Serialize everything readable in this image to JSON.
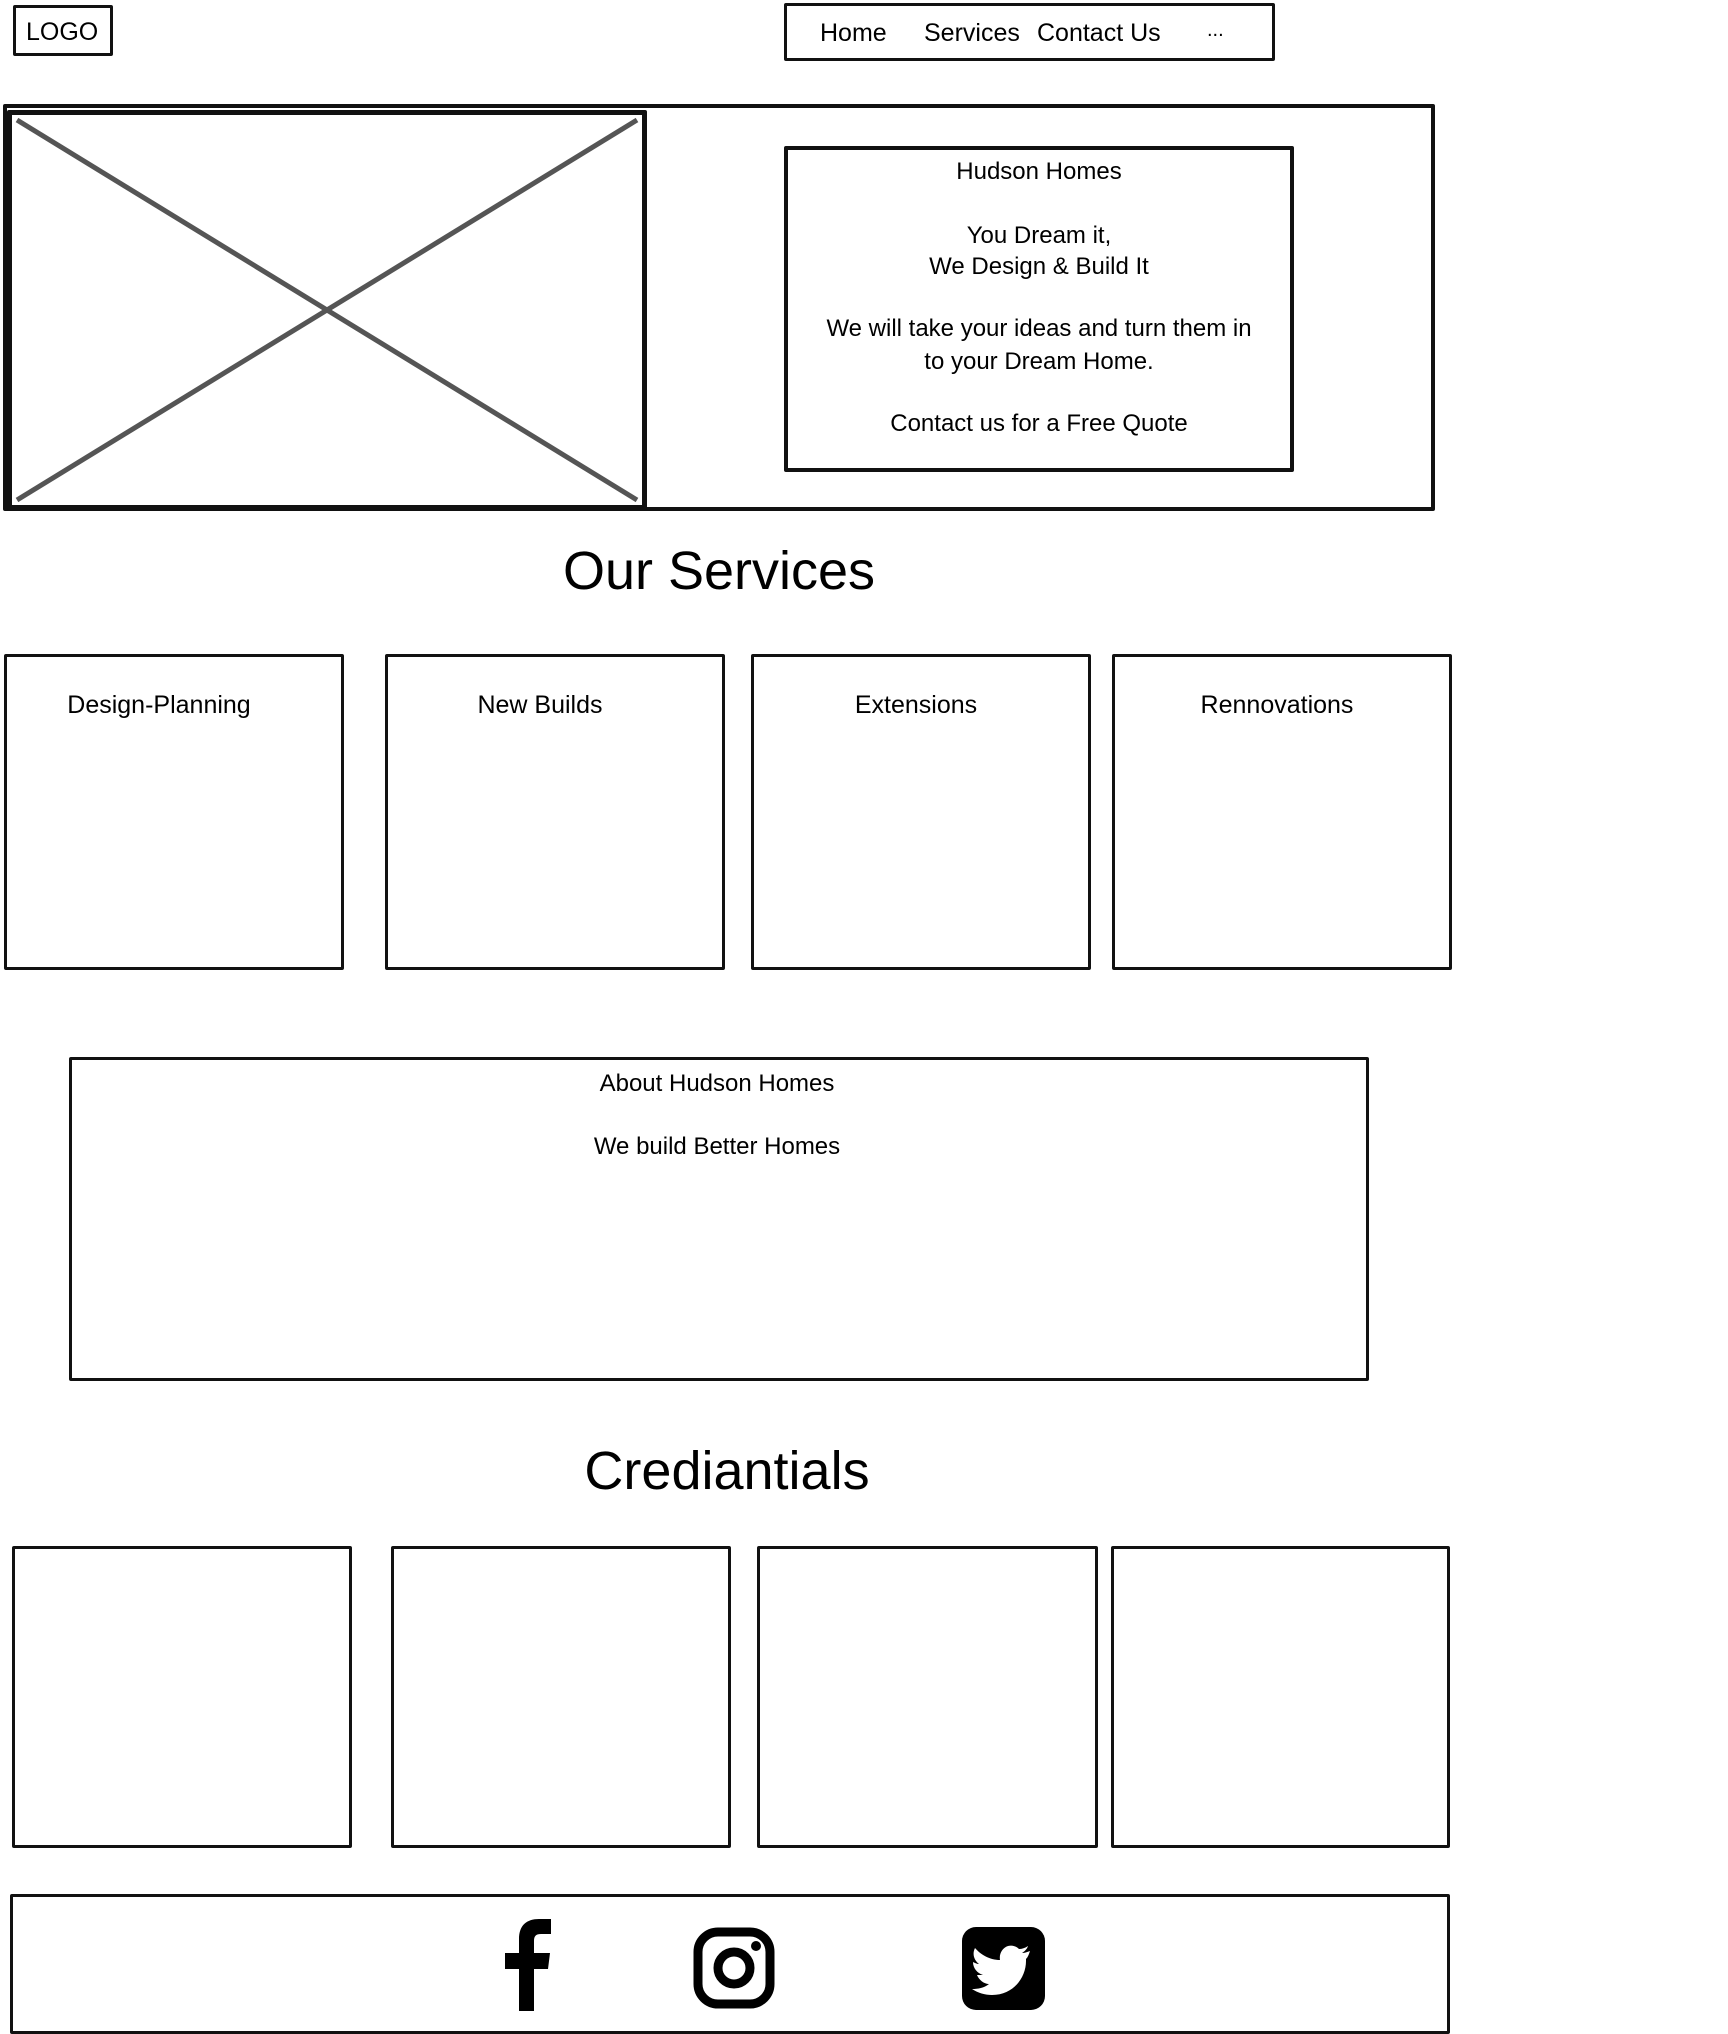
{
  "header": {
    "logo": "LOGO",
    "nav": [
      {
        "label": "Home"
      },
      {
        "label": "Services"
      },
      {
        "label": "Contact Us"
      },
      {
        "label": "..."
      }
    ]
  },
  "hero": {
    "title": "Hudson Homes",
    "tagline_1": "You Dream it,",
    "tagline_2": "We Design & Build It",
    "body_1": "We will take your ideas and turn them in",
    "body_2": "to your Dream Home.",
    "cta": "Contact us for a Free Quote"
  },
  "services": {
    "heading": "Our Services",
    "items": [
      {
        "label": "Design-Planning"
      },
      {
        "label": "New Builds"
      },
      {
        "label": "Extensions"
      },
      {
        "label": "Rennovations"
      }
    ]
  },
  "about": {
    "title": "About Hudson Homes",
    "text": "We build Better Homes"
  },
  "credentials": {
    "heading": "Crediantials"
  },
  "footer": {
    "icons": [
      "facebook-icon",
      "instagram-icon",
      "twitter-icon"
    ]
  }
}
